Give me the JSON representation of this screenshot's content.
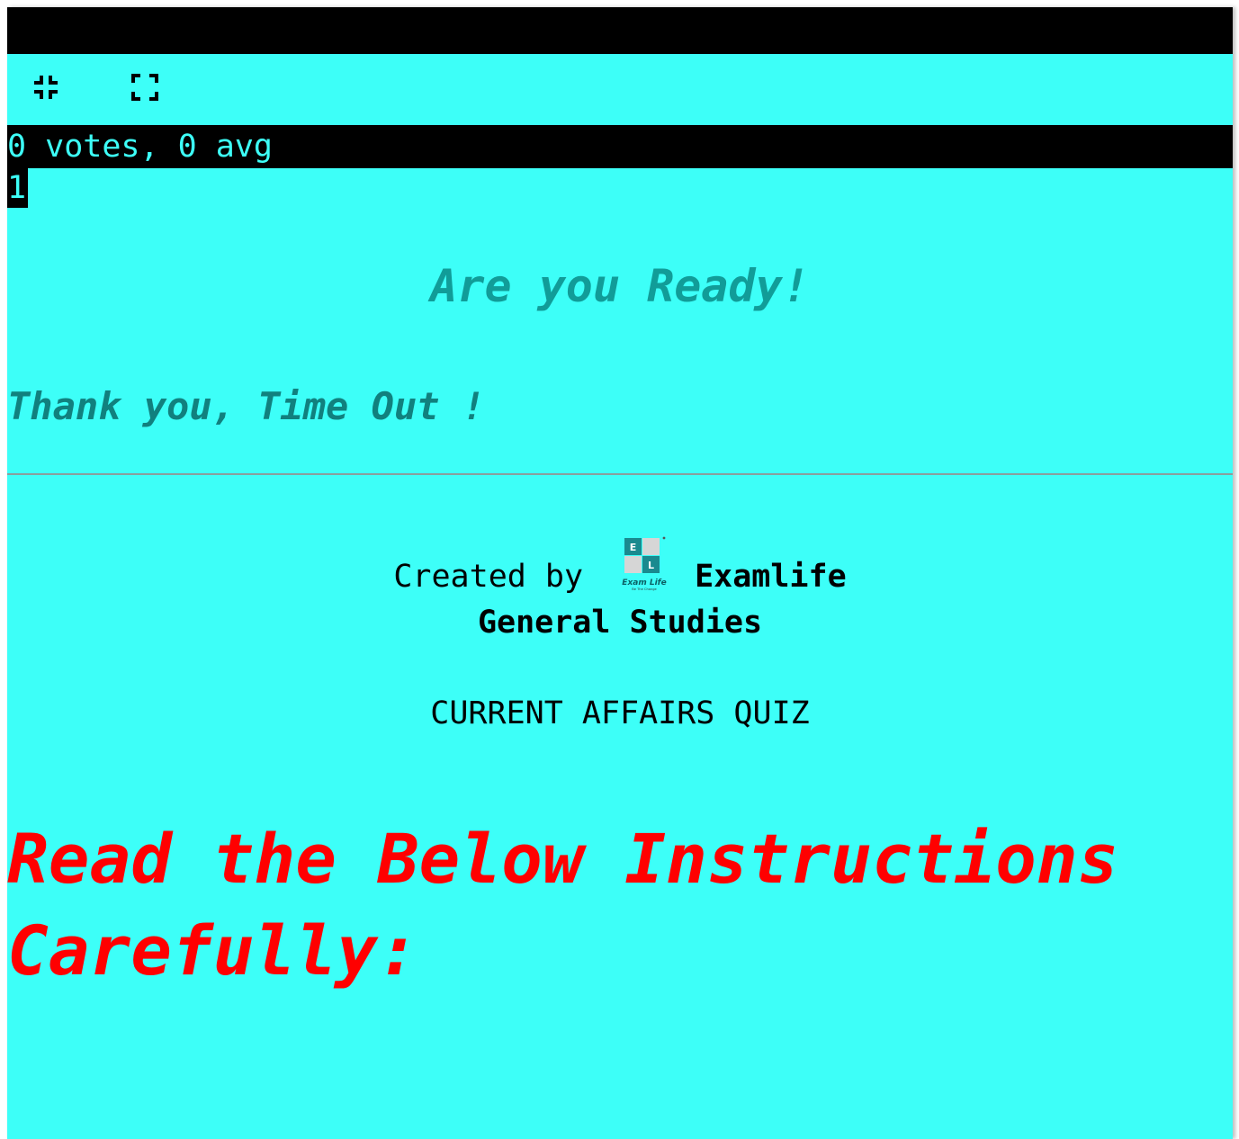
{
  "toolbar": {
    "exit_fullscreen_icon": "exit-fullscreen-icon",
    "enter_fullscreen_icon": "fullscreen-icon"
  },
  "rating": {
    "text": "0 votes, 0 avg"
  },
  "question_number": "1",
  "quiz": {
    "ready_text": "Are you Ready!",
    "timeout_text": "Thank you, Time Out !",
    "created_by_label": "Created by",
    "creator_name": "Examlife",
    "category": "General Studies",
    "title": "CURRENT AFFAIRS QUIZ",
    "instructions_heading": "Read the Below Instructions Carefully:"
  },
  "logo": {
    "letter_top": "E",
    "letter_bottom": "L",
    "wordmark": "Exam Life",
    "tagline": "Be The Change"
  },
  "colors": {
    "background": "#3dfff8",
    "bar": "#000000",
    "ready": "#119c98",
    "timeout": "#11807e",
    "instructions": "#ff0000"
  }
}
